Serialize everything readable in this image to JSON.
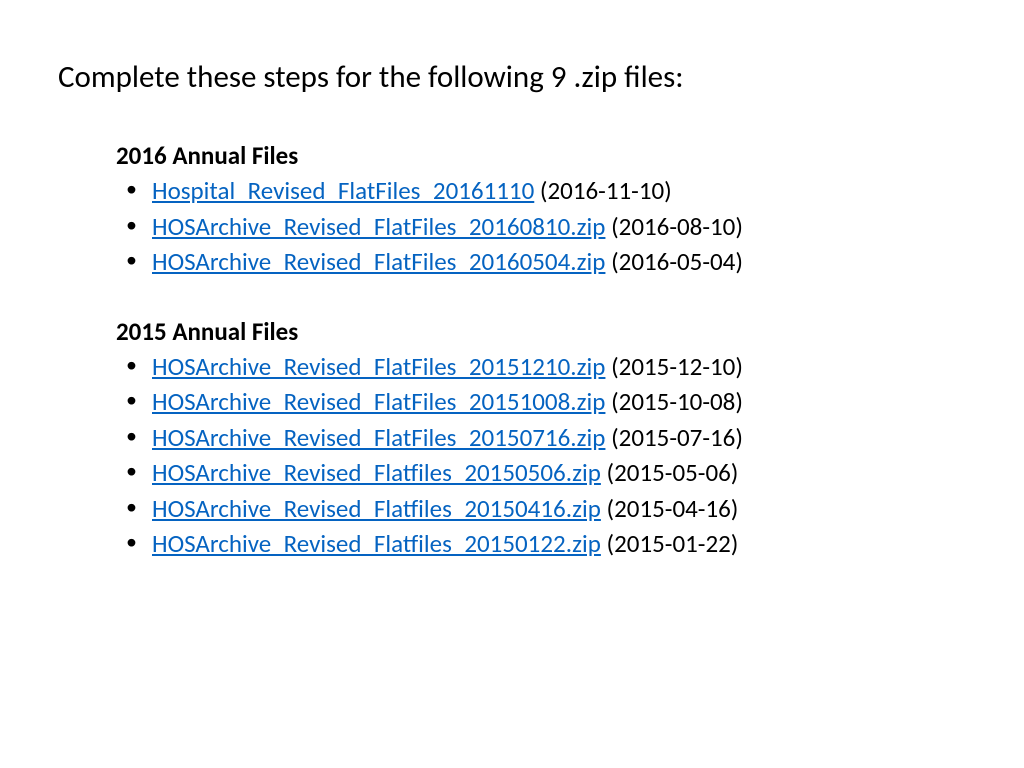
{
  "title": "Complete these steps for the following 9 .zip files:",
  "sections": [
    {
      "heading": "2016 Annual Files",
      "items": [
        {
          "link": "Hospital_Revised_FlatFiles_20161110",
          "date": "(2016-11-10)"
        },
        {
          "link": "HOSArchive_Revised_FlatFiles_20160810.zip",
          "date": "(2016-08-10)"
        },
        {
          "link": "HOSArchive_Revised_FlatFiles_20160504.zip",
          "date": "(2016-05-04)"
        }
      ]
    },
    {
      "heading": "2015 Annual Files",
      "items": [
        {
          "link": "HOSArchive_Revised_FlatFiles_20151210.zip",
          "date": "(2015-12-10)"
        },
        {
          "link": "HOSArchive_Revised_FlatFiles_20151008.zip",
          "date": "(2015-10-08)"
        },
        {
          "link": "HOSArchive_Revised_FlatFiles_20150716.zip",
          "date": "(2015-07-16)"
        },
        {
          "link": "HOSArchive_Revised_Flatfiles_20150506.zip",
          "date": "(2015-05-06)"
        },
        {
          "link": "HOSArchive_Revised_Flatfiles_20150416.zip",
          "date": "(2015-04-16)"
        },
        {
          "link": "HOSArchive_Revised_Flatfiles_20150122.zip",
          "date": "(2015-01-22)"
        }
      ]
    }
  ]
}
